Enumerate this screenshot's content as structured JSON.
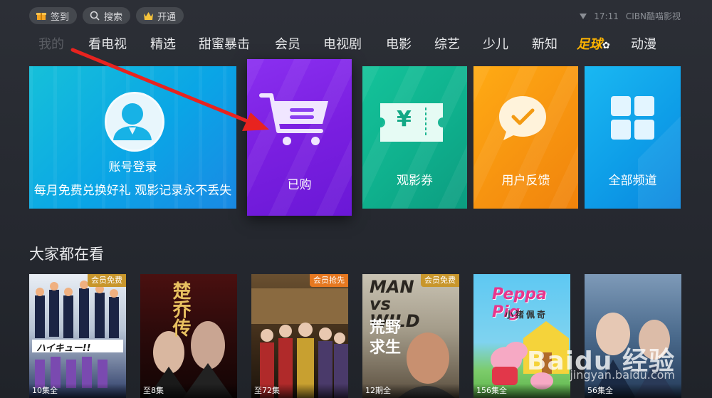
{
  "topbar": {
    "checkin": "签到",
    "search": "搜索",
    "vip": "开通"
  },
  "status": {
    "time": "17:11",
    "brand": "CIBN酷喵影视"
  },
  "nav": [
    "我的",
    "看电视",
    "精选",
    "甜蜜暴击",
    "会员",
    "电视剧",
    "电影",
    "综艺",
    "少儿",
    "新知",
    "足球",
    "动漫"
  ],
  "tiles": {
    "account": {
      "title": "账号登录",
      "subtitle": "每月免费兑换好礼 观影记录永不丢失"
    },
    "bought": {
      "label": "已购"
    },
    "ticket": {
      "label": "观影券",
      "symbol": "¥"
    },
    "feedback": {
      "label": "用户反馈"
    },
    "channels": {
      "label": "全部频道"
    }
  },
  "section": {
    "title": "大家都在看"
  },
  "posters": [
    {
      "badge": "会员免费",
      "eps": "10集全"
    },
    {
      "badge": "",
      "eps": "至8集",
      "title": "楚乔传"
    },
    {
      "badge": "会员抢先",
      "eps": "至72集"
    },
    {
      "badge": "会员免费",
      "eps": "12期全",
      "title_en": "MAN vs WILD",
      "title": "荒野求生"
    },
    {
      "badge": "",
      "eps": "156集全",
      "title_en": "Peppa Pig",
      "title": "小猪佩奇"
    },
    {
      "badge": "",
      "eps": "56集全"
    }
  ],
  "watermark": {
    "text": "Baidu 经验",
    "url": "jingyan.baidu.com"
  },
  "colors": {
    "bought": "#7a1fe0",
    "arrow": "#e8231f",
    "gold": "#ffb400"
  }
}
